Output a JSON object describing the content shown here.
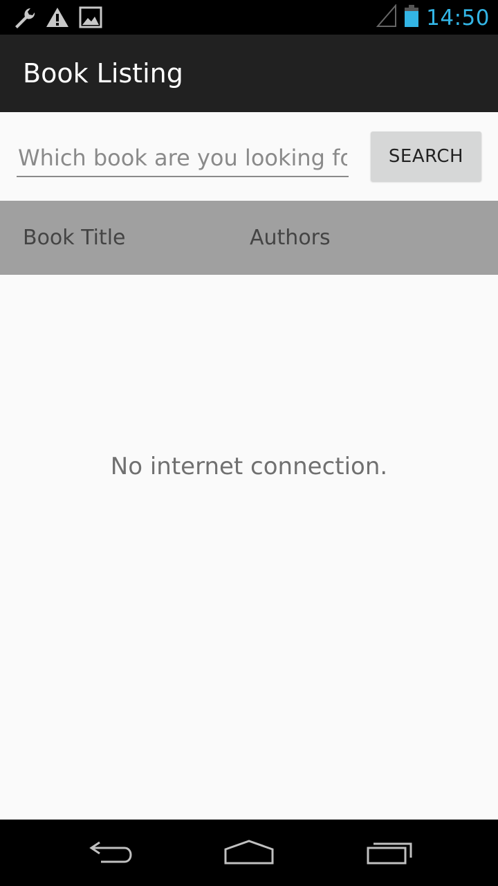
{
  "status_bar": {
    "time": "14:50",
    "icons": [
      "wrench-icon",
      "warning-icon",
      "image-icon",
      "signal-icon",
      "battery-icon"
    ],
    "clock_color": "#33b5e5"
  },
  "action_bar": {
    "title": "Book Listing",
    "background": "#212121"
  },
  "search": {
    "placeholder": "Which book are you looking for?",
    "value": "",
    "button_label": "SEARCH"
  },
  "table": {
    "columns": [
      "Book Title",
      "Authors"
    ],
    "header_background": "#a0a0a0"
  },
  "content": {
    "empty_message": "No internet connection."
  },
  "nav_bar": {
    "buttons": [
      "back-icon",
      "home-icon",
      "recents-icon"
    ]
  }
}
